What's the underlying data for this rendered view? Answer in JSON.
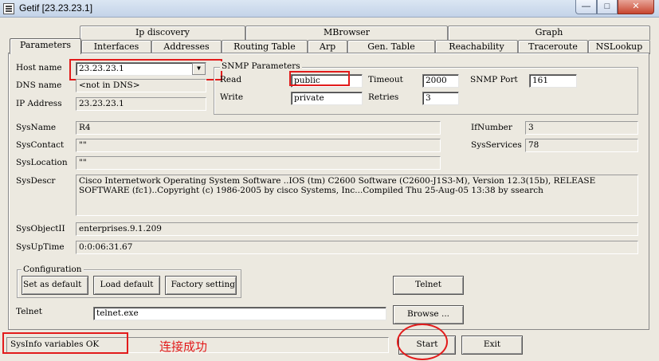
{
  "window": {
    "title": "Getif [23.23.23.1]",
    "min_glyph": "—",
    "max_glyph": "□",
    "close_glyph": "✕"
  },
  "tabs": {
    "top_row": [
      "Ip discovery",
      "MBrowser",
      "Graph"
    ],
    "bottom_row": [
      "Parameters",
      "Interfaces",
      "Addresses",
      "Routing Table",
      "Arp",
      "Gen. Table",
      "Reachability",
      "Traceroute",
      "NSLookup"
    ],
    "active": "Parameters"
  },
  "host": {
    "host_name_label": "Host name",
    "host_name_value": "23.23.23.1",
    "dns_label": "DNS name",
    "dns_value": "<not in DNS>",
    "ip_label": "IP Address",
    "ip_value": "23.23.23.1"
  },
  "snmp": {
    "group_title": "SNMP Parameters",
    "read_label": "Read",
    "read_value": "public",
    "write_label": "Write",
    "write_value": "private",
    "timeout_label": "Timeout",
    "timeout_value": "2000",
    "retries_label": "Retries",
    "retries_value": "3",
    "port_label": "SNMP Port",
    "port_value": "161"
  },
  "sys": {
    "name_label": "SysName",
    "name_value": "R4",
    "contact_label": "SysContact",
    "contact_value": "\"\"",
    "location_label": "SysLocation",
    "location_value": "\"\"",
    "descr_label": "SysDescr",
    "descr_line1": "Cisco Internetwork Operating System Software ..IOS (tm) C2600 Software (C2600-J1S3-M), Version 12.3(15b), RELEASE",
    "descr_line2": "SOFTWARE (fc1)..Copyright (c) 1986-2005 by cisco Systems, Inc...Compiled Thu 25-Aug-05 13:38 by ssearch",
    "objectid_label": "SysObjectII",
    "objectid_value": "enterprises.9.1.209",
    "uptime_label": "SysUpTime",
    "uptime_value": "0:0:06:31.67",
    "ifnumber_label": "IfNumber",
    "ifnumber_value": "3",
    "services_label": "SysServices",
    "services_value": "78"
  },
  "config": {
    "group_title": "Configuration",
    "set_default": "Set as default",
    "load_default": "Load default",
    "factory_setting": "Factory setting"
  },
  "telnet": {
    "label": "Telnet",
    "program_value": "telnet.exe",
    "telnet_button": "Telnet",
    "browse_button": "Browse ..."
  },
  "status": {
    "text": "SysInfo variables OK",
    "annotation": "连接成功"
  },
  "actions": {
    "start": "Start",
    "exit": "Exit"
  },
  "colors": {
    "annotation_red": "#e21b1b",
    "window_bg": "#ece9e0"
  }
}
